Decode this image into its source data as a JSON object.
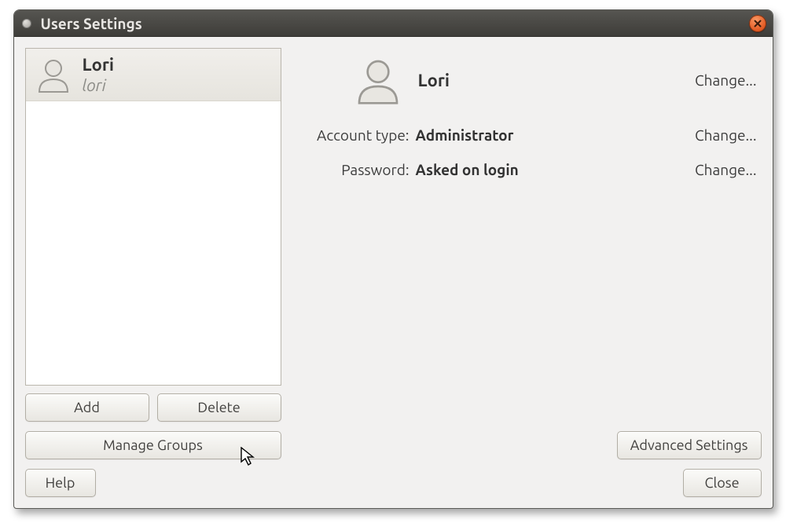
{
  "window": {
    "title": "Users Settings"
  },
  "sidebar": {
    "users": [
      {
        "display_name": "Lori",
        "username": "lori"
      }
    ],
    "buttons": {
      "add": "Add",
      "delete": "Delete",
      "manage_groups": "Manage Groups",
      "help": "Help"
    }
  },
  "detail": {
    "name": "Lori",
    "change_label": "Change...",
    "rows": {
      "account_type": {
        "label": "Account type:",
        "value": "Administrator"
      },
      "password": {
        "label": "Password:",
        "value": "Asked on login"
      }
    },
    "buttons": {
      "advanced": "Advanced Settings",
      "close": "Close"
    }
  },
  "icons": {
    "user": "user-icon",
    "close": "close-icon"
  }
}
